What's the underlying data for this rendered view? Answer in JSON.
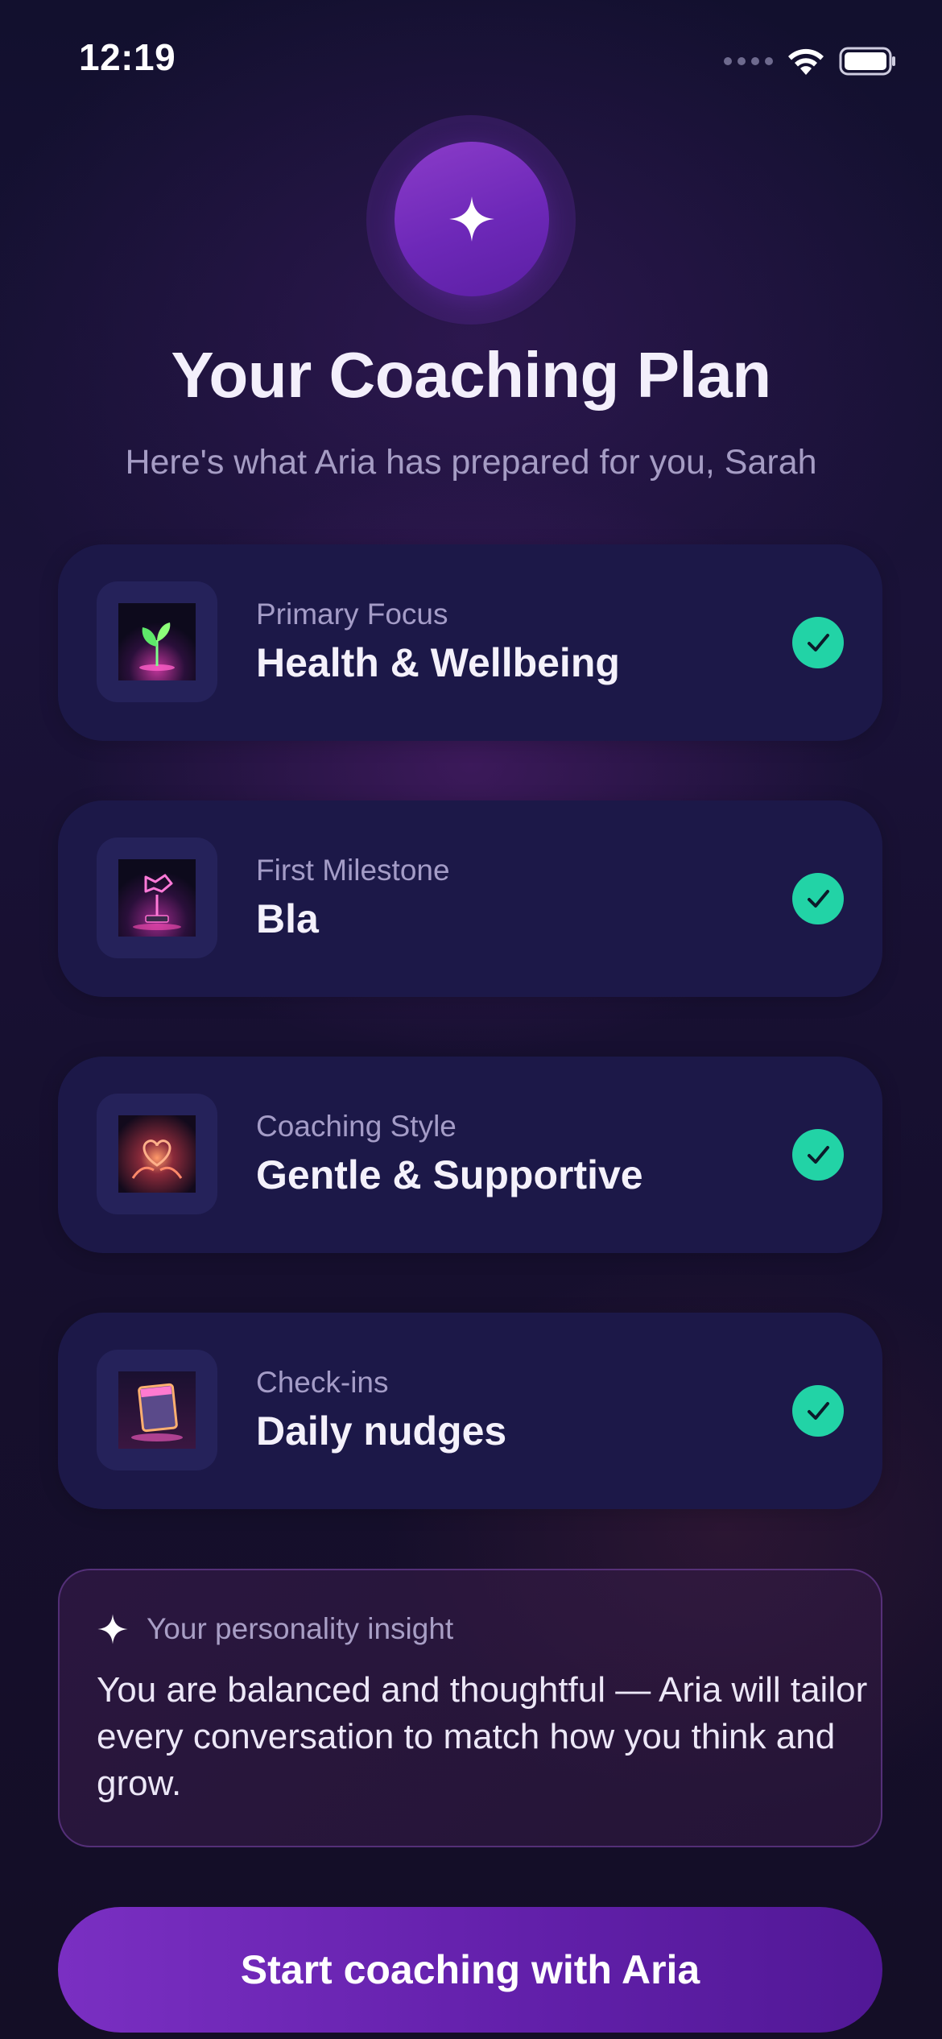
{
  "status_bar": {
    "time": "12:19",
    "icons": [
      "signal-dots-icon",
      "wifi-icon",
      "battery-icon"
    ]
  },
  "header": {
    "badge_icon": "sparkle-icon",
    "title": "Your Coaching Plan",
    "subtitle": "Here's what Aria has prepared for you, Sarah"
  },
  "plan": {
    "items": [
      {
        "label": "Primary Focus",
        "value": "Health & Wellbeing",
        "icon": "seedling-icon",
        "status": "check-icon"
      },
      {
        "label": "First Milestone",
        "value": "Bla",
        "icon": "neon-flag-icon",
        "status": "check-icon"
      },
      {
        "label": "Coaching Style",
        "value": "Gentle & Supportive",
        "icon": "heart-hands-icon",
        "status": "check-icon"
      },
      {
        "label": "Check-ins",
        "value": "Daily nudges",
        "icon": "calendar-icon",
        "status": "check-icon"
      }
    ]
  },
  "insight": {
    "icon": "sparkle-icon",
    "title": "Your personality insight",
    "body": "You are balanced and thoughtful — Aria will tailor every conversation to match how you think and grow."
  },
  "cta": {
    "label": "Start coaching with Aria"
  },
  "colors": {
    "accent_purple": "#7a2fc2",
    "check_green": "#22d3a6",
    "card_bg": "#1c1848",
    "background": "#12102e"
  }
}
